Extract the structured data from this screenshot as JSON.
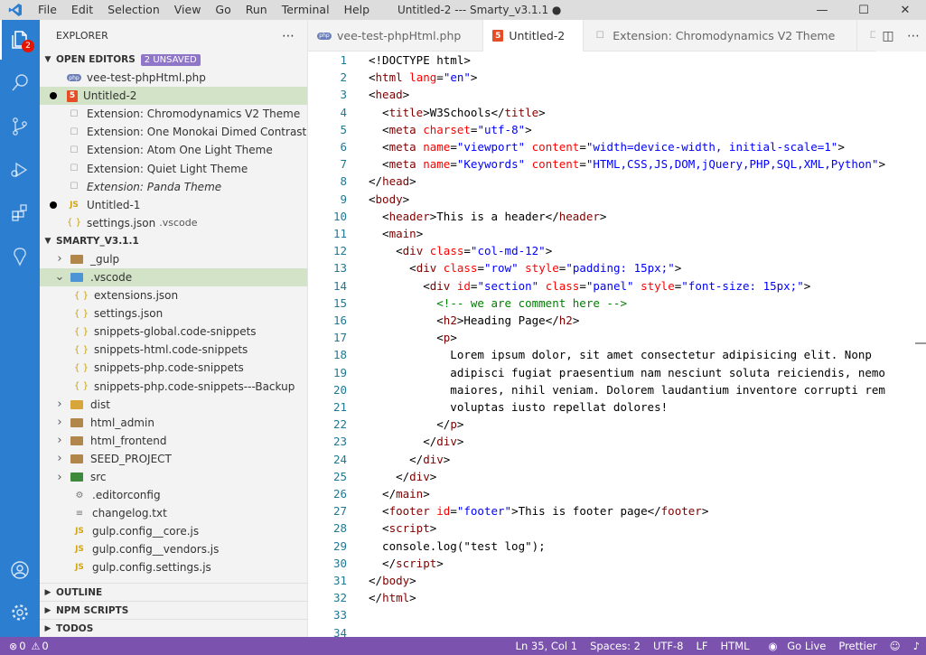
{
  "titlebar": {
    "menu": [
      "File",
      "Edit",
      "Selection",
      "View",
      "Go",
      "Run",
      "Terminal",
      "Help"
    ],
    "window_title": "Untitled-2 --- Smarty_v3.1.1 ●"
  },
  "activity": {
    "badge": "2"
  },
  "sidebar": {
    "title": "EXPLORER",
    "open_editors": {
      "label": "OPEN EDITORS",
      "badge": "2 UNSAVED",
      "items": [
        {
          "label": "vee-test-phpHtml.php",
          "desc": "",
          "icon": "php-icon",
          "dirty": false,
          "selected": false,
          "italic": false
        },
        {
          "label": "Untitled-2",
          "desc": "",
          "icon": "html5-icon",
          "dirty": true,
          "selected": true,
          "italic": false
        },
        {
          "label": "Extension: Chromodynamics V2 Theme",
          "desc": "",
          "icon": "page-icon",
          "dirty": false,
          "selected": false,
          "italic": false
        },
        {
          "label": "Extension: One Monokai Dimed Contrast",
          "desc": "",
          "icon": "page-icon",
          "dirty": false,
          "selected": false,
          "italic": false
        },
        {
          "label": "Extension: Atom One Light Theme",
          "desc": "",
          "icon": "page-icon",
          "dirty": false,
          "selected": false,
          "italic": false
        },
        {
          "label": "Extension: Quiet Light Theme",
          "desc": "",
          "icon": "page-icon",
          "dirty": false,
          "selected": false,
          "italic": false
        },
        {
          "label": "Extension: Panda Theme",
          "desc": "",
          "icon": "page-icon",
          "dirty": false,
          "selected": false,
          "italic": true
        },
        {
          "label": "Untitled-1",
          "desc": "",
          "icon": "js-icon",
          "dirty": true,
          "selected": false,
          "italic": false
        },
        {
          "label": "settings.json",
          "desc": ".vscode",
          "icon": "json-icon",
          "dirty": false,
          "selected": false,
          "italic": false
        }
      ]
    },
    "project": {
      "label": "SMARTY_V3.1.1",
      "items": [
        {
          "label": "_gulp",
          "type": "folder",
          "indent": 1,
          "open": false
        },
        {
          "label": ".vscode",
          "type": "vscode-folder",
          "indent": 1,
          "open": true,
          "selected": true
        },
        {
          "label": "extensions.json",
          "type": "json",
          "indent": 2
        },
        {
          "label": "settings.json",
          "type": "json",
          "indent": 2
        },
        {
          "label": "snippets-global.code-snippets",
          "type": "json",
          "indent": 2
        },
        {
          "label": "snippets-html.code-snippets",
          "type": "json",
          "indent": 2
        },
        {
          "label": "snippets-php.code-snippets",
          "type": "json",
          "indent": 2
        },
        {
          "label": "snippets-php.code-snippets---Backup",
          "type": "json",
          "indent": 2
        },
        {
          "label": "dist",
          "type": "dist-folder",
          "indent": 1,
          "open": false
        },
        {
          "label": "html_admin",
          "type": "folder",
          "indent": 1,
          "open": false
        },
        {
          "label": "html_frontend",
          "type": "folder",
          "indent": 1,
          "open": false
        },
        {
          "label": "SEED_PROJECT",
          "type": "folder",
          "indent": 1,
          "open": false
        },
        {
          "label": "src",
          "type": "src-folder",
          "indent": 1,
          "open": false
        },
        {
          "label": ".editorconfig",
          "type": "config",
          "indent": 1
        },
        {
          "label": "changelog.txt",
          "type": "txt",
          "indent": 1
        },
        {
          "label": "gulp.config__core.js",
          "type": "js",
          "indent": 1
        },
        {
          "label": "gulp.config__vendors.js",
          "type": "js",
          "indent": 1
        },
        {
          "label": "gulp.config.settings.js",
          "type": "js",
          "indent": 1
        }
      ]
    },
    "bottom_sections": [
      "OUTLINE",
      "NPM SCRIPTS",
      "TODOS"
    ]
  },
  "tabs": [
    {
      "label": "vee-test-phpHtml.php",
      "icon": "php-icon",
      "active": false,
      "dirty": false
    },
    {
      "label": "Untitled-2",
      "icon": "html5-icon",
      "active": true,
      "dirty": true
    },
    {
      "label": "Extension: Chromodynamics V2 Theme",
      "icon": "page-icon",
      "active": false,
      "dirty": false
    },
    {
      "label": "Extension",
      "icon": "page-icon",
      "active": false,
      "dirty": false
    }
  ],
  "colors": {
    "tag": "#800000",
    "attr": "#ff0000",
    "string": "#0000ff",
    "comment": "#008000",
    "text": "#000000",
    "statusbar": "#7b52ae",
    "activitybar": "#2c7ed0"
  },
  "editor": {
    "lines": [
      [
        [
          "p",
          "<!DOCTYPE html>"
        ]
      ],
      [
        [
          "p",
          "<"
        ],
        [
          "t",
          "html"
        ],
        [
          "p",
          " "
        ],
        [
          "a",
          "lang"
        ],
        [
          "p",
          "="
        ],
        [
          "s",
          "\"en\""
        ],
        [
          "p",
          ">"
        ]
      ],
      [
        [
          "p",
          "<"
        ],
        [
          "t",
          "head"
        ],
        [
          "p",
          ">"
        ]
      ],
      [
        [
          "p",
          "  <"
        ],
        [
          "t",
          "title"
        ],
        [
          "p",
          ">W3Schools</"
        ],
        [
          "t",
          "title"
        ],
        [
          "p",
          ">"
        ]
      ],
      [
        [
          "p",
          "  <"
        ],
        [
          "t",
          "meta"
        ],
        [
          "p",
          " "
        ],
        [
          "a",
          "charset"
        ],
        [
          "p",
          "="
        ],
        [
          "s",
          "\"utf-8\""
        ],
        [
          "p",
          ">"
        ]
      ],
      [
        [
          "p",
          "  <"
        ],
        [
          "t",
          "meta"
        ],
        [
          "p",
          " "
        ],
        [
          "a",
          "name"
        ],
        [
          "p",
          "="
        ],
        [
          "s",
          "\"viewport\""
        ],
        [
          "p",
          " "
        ],
        [
          "a",
          "content"
        ],
        [
          "p",
          "="
        ],
        [
          "s",
          "\"width=device-width, initial-scale=1\""
        ],
        [
          "p",
          ">"
        ]
      ],
      [
        [
          "p",
          "  <"
        ],
        [
          "t",
          "meta"
        ],
        [
          "p",
          " "
        ],
        [
          "a",
          "name"
        ],
        [
          "p",
          "="
        ],
        [
          "s",
          "\"Keywords\""
        ],
        [
          "p",
          " "
        ],
        [
          "a",
          "content"
        ],
        [
          "p",
          "="
        ],
        [
          "s",
          "\"HTML,CSS,JS,DOM,jQuery,PHP,SQL,XML,Python\""
        ],
        [
          "p",
          ">"
        ]
      ],
      [
        [
          "p",
          "</"
        ],
        [
          "t",
          "head"
        ],
        [
          "p",
          ">"
        ]
      ],
      [
        [
          "p",
          "<"
        ],
        [
          "t",
          "body"
        ],
        [
          "p",
          ">"
        ]
      ],
      [
        [
          "p",
          "  <"
        ],
        [
          "t",
          "header"
        ],
        [
          "p",
          ">This is a header</"
        ],
        [
          "t",
          "header"
        ],
        [
          "p",
          ">"
        ]
      ],
      [
        [
          "p",
          "  <"
        ],
        [
          "t",
          "main"
        ],
        [
          "p",
          ">"
        ]
      ],
      [
        [
          "p",
          "    <"
        ],
        [
          "t",
          "div"
        ],
        [
          "p",
          " "
        ],
        [
          "a",
          "class"
        ],
        [
          "p",
          "="
        ],
        [
          "s",
          "\"col-md-12\""
        ],
        [
          "p",
          ">"
        ]
      ],
      [
        [
          "p",
          "      <"
        ],
        [
          "t",
          "div"
        ],
        [
          "p",
          " "
        ],
        [
          "a",
          "class"
        ],
        [
          "p",
          "="
        ],
        [
          "s",
          "\"row\""
        ],
        [
          "p",
          " "
        ],
        [
          "a",
          "style"
        ],
        [
          "p",
          "="
        ],
        [
          "s",
          "\"padding: 15px;\""
        ],
        [
          "p",
          ">"
        ]
      ],
      [
        [
          "p",
          "        <"
        ],
        [
          "t",
          "div"
        ],
        [
          "p",
          " "
        ],
        [
          "a",
          "id"
        ],
        [
          "p",
          "="
        ],
        [
          "s",
          "\"section\""
        ],
        [
          "p",
          " "
        ],
        [
          "a",
          "class"
        ],
        [
          "p",
          "="
        ],
        [
          "s",
          "\"panel\""
        ],
        [
          "p",
          " "
        ],
        [
          "a",
          "style"
        ],
        [
          "p",
          "="
        ],
        [
          "s",
          "\"font-size: 15px;\""
        ],
        [
          "p",
          ">"
        ]
      ],
      [
        [
          "p",
          "          "
        ],
        [
          "c",
          "<!-- we are comment here -->"
        ]
      ],
      [
        [
          "p",
          "          <"
        ],
        [
          "t",
          "h2"
        ],
        [
          "p",
          ">Heading Page</"
        ],
        [
          "t",
          "h2"
        ],
        [
          "p",
          ">"
        ]
      ],
      [
        [
          "p",
          "          <"
        ],
        [
          "t",
          "p"
        ],
        [
          "p",
          ">"
        ]
      ],
      [
        [
          "p",
          "            Lorem ipsum dolor, sit amet consectetur adipisicing elit. Nonp"
        ]
      ],
      [
        [
          "p",
          "            adipisci fugiat praesentium nam nesciunt soluta reiciendis, nemo"
        ]
      ],
      [
        [
          "p",
          "            maiores, nihil veniam. Dolorem laudantium inventore corrupti rem"
        ]
      ],
      [
        [
          "p",
          "            voluptas iusto repellat dolores!"
        ]
      ],
      [
        [
          "p",
          "          </"
        ],
        [
          "t",
          "p"
        ],
        [
          "p",
          ">"
        ]
      ],
      [
        [
          "p",
          "        </"
        ],
        [
          "t",
          "div"
        ],
        [
          "p",
          ">"
        ]
      ],
      [
        [
          "p",
          "      </"
        ],
        [
          "t",
          "div"
        ],
        [
          "p",
          ">"
        ]
      ],
      [
        [
          "p",
          "    </"
        ],
        [
          "t",
          "div"
        ],
        [
          "p",
          ">"
        ]
      ],
      [
        [
          "p",
          "  </"
        ],
        [
          "t",
          "main"
        ],
        [
          "p",
          ">"
        ]
      ],
      [
        [
          "p",
          "  <"
        ],
        [
          "t",
          "footer"
        ],
        [
          "p",
          " "
        ],
        [
          "a",
          "id"
        ],
        [
          "p",
          "="
        ],
        [
          "s",
          "\"footer\""
        ],
        [
          "p",
          ">This is footer page</"
        ],
        [
          "t",
          "footer"
        ],
        [
          "p",
          ">"
        ]
      ],
      [
        [
          "p",
          "  <"
        ],
        [
          "t",
          "script"
        ],
        [
          "p",
          ">"
        ]
      ],
      [
        [
          "p",
          "  console.log(\"test log\");"
        ]
      ],
      [
        [
          "p",
          "  </"
        ],
        [
          "t",
          "script"
        ],
        [
          "p",
          ">"
        ]
      ],
      [
        [
          "p",
          "</"
        ],
        [
          "t",
          "body"
        ],
        [
          "p",
          ">"
        ]
      ],
      [
        [
          "p",
          "</"
        ],
        [
          "t",
          "html"
        ],
        [
          "p",
          ">"
        ]
      ],
      [
        [
          "p",
          ""
        ]
      ],
      [
        [
          "p",
          ""
        ]
      ]
    ],
    "line_numbers": [
      "1",
      "2",
      "3",
      "4",
      "5",
      "6",
      "7",
      "8",
      "9",
      "10",
      "11",
      "12",
      "13",
      "14",
      "15",
      "16",
      "17",
      "18",
      "19",
      "20",
      "21",
      "22",
      "23",
      "24",
      "25",
      "26",
      "27",
      "28",
      "29",
      "30",
      "31",
      "32",
      "33",
      "34"
    ]
  },
  "statusbar": {
    "errors": "0",
    "warnings": "0",
    "right": [
      "Ln 35, Col 1",
      "Spaces: 2",
      "UTF-8",
      "LF",
      "HTML",
      "Go Live",
      "Prettier"
    ]
  }
}
